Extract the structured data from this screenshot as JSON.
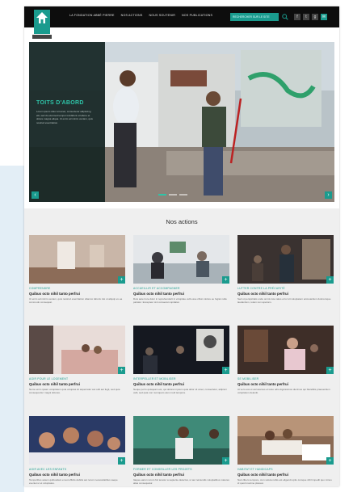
{
  "nav": {
    "items": [
      "LA FONDATION ABBÉ PIERRE",
      "NOS ACTIONS",
      "NOUS SOUTENIR",
      "NOS PUBLICATIONS"
    ],
    "search_placeholder": "RECHERCHER SUR LE SITE",
    "socials": [
      "f",
      "t",
      "g",
      "✉"
    ]
  },
  "hero": {
    "title": "TOITS D'ABORD",
    "description": "Lorem ipsum dolor sit amet, consectetur adipiscing elit, sed do eiusmod tempor incididunt ut labore et dolore magna aliqua. Ut enim ad minim veniam, quis nostrud exercitation."
  },
  "actions": {
    "title": "Nos actions",
    "items": [
      {
        "category": "COMPRENDRE",
        "title": "Quibus octo nihil tanto perfrui",
        "description": "Ut enim ad minim veniam, quis nostrud exercitation ullamco laboris nisi ut aliquip ex ea commodo consequat."
      },
      {
        "category": "ACCUEILLIR ET ACCOMPAGNER",
        "title": "Quibus octo nihil tanto perfrui",
        "description": "Duis aute irure dolor in reprehenderit in voluptate velit esse cillum dolore eu fugiat nulla pariatur. Excepteur sint occaecat cupidatat."
      },
      {
        "category": "LUTTER CONTRE LA PRÉCARITÉ",
        "title": "Quibus octo nihil tanto perfrui",
        "description": "Sed ut perspiciatis unde omnis iste natus error sit voluptatem accusantium doloremque laudantium, totam rem aperiam."
      },
      {
        "category": "AGIR POUR LE LOGEMENT",
        "title": "Quibus octo nihil tanto perfrui",
        "description": "Nemo enim ipsam voluptatem quia voluptas sit aspernatur aut odit aut fugit, sed quia consequuntur magni dolores."
      },
      {
        "category": "INTERPELLER ET MOBILISER",
        "title": "Quibus octo nihil tanto perfrui",
        "description": "Neque porro quisquam est, qui dolorem ipsum quia dolor sit amet, consectetur, adipisci velit, sed quia non numquam eius modi tempora."
      },
      {
        "category": "SE MOBILISER",
        "title": "Quibus octo nihil tanto perfrui",
        "description": "At vero eos et accusamus et iusto odio dignissimos ducimus qui blanditiis praesentium voluptatum deleniti."
      },
      {
        "category": "AGIR AVEC LES ENFANTS",
        "title": "Quibus octo nihil tanto perfrui",
        "description": "Temporibus autem quibusdam et aut officiis debitis aut rerum necessitatibus saepe eveniet ut et voluptates."
      },
      {
        "category": "FORMER ET CONSEILLER LES PROJETS",
        "title": "Quibus octo nihil tanto perfrui",
        "description": "Itaque earum rerum hic tenetur a sapiente delectus, ut aut reiciendis voluptatibus maiores alias consequatur."
      },
      {
        "category": "HABITAT ET HANDICAPS",
        "title": "Quibus octo nihil tanto perfrui",
        "description": "Nam libero tempore, cum soluta nobis est eligendi optio cumque nihil impedit quo minus id quod maxime placeat."
      }
    ]
  }
}
